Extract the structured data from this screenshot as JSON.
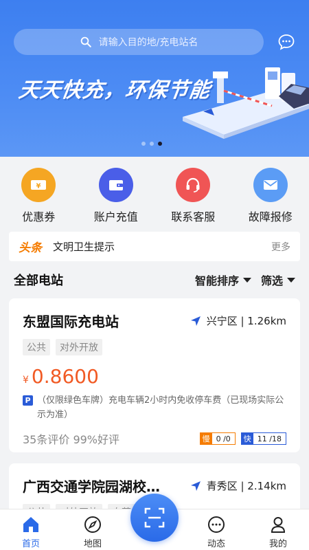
{
  "search": {
    "placeholder": "请输入目的地/充电站名",
    "icon": "search-icon"
  },
  "banner": {
    "slogan": "天天快充，环保节能",
    "carousel_active": 3,
    "carousel_count": 3
  },
  "quick_menu": [
    {
      "label": "优惠券",
      "icon": "coupon-icon",
      "color": "#f5a623"
    },
    {
      "label": "账户充值",
      "icon": "wallet-icon",
      "color": "#4a5ee8"
    },
    {
      "label": "联系客服",
      "icon": "headset-icon",
      "color": "#f05555"
    },
    {
      "label": "故障报修",
      "icon": "mail-icon",
      "color": "#5b9cf5"
    }
  ],
  "headline": {
    "tag": "头条",
    "text": "文明卫生提示",
    "more": "更多"
  },
  "section": {
    "title": "全部电站",
    "sort": "智能排序",
    "filter": "筛选"
  },
  "stations": [
    {
      "name": "东盟国际充电站",
      "district": "兴宁区",
      "distance": "1.26km",
      "tags": [
        "公共",
        "对外开放"
      ],
      "currency": "¥",
      "price": "0.8600",
      "parking_badge": "P",
      "parking_note": "（仅限绿色车牌）充电车辆2小时内免收停车费（已现场实际公示为准）",
      "reviews": "35条评价 99%好评",
      "slow_label": "慢",
      "slow_value": "0 /0",
      "fast_label": "快",
      "fast_value": "11 /18"
    },
    {
      "name": "广西交通学院园湖校…",
      "district": "青秀区",
      "distance": "2.14km",
      "tags": [
        "公共",
        "对外开放",
        "自营"
      ]
    }
  ],
  "tabbar": [
    {
      "label": "首页",
      "icon": "home-icon",
      "active": true
    },
    {
      "label": "地图",
      "icon": "compass-icon",
      "active": false
    },
    {
      "label": "",
      "icon": "scan-icon",
      "active": false
    },
    {
      "label": "动态",
      "icon": "chat-bubble-icon",
      "active": false
    },
    {
      "label": "我的",
      "icon": "user-icon",
      "active": false
    }
  ],
  "colors": {
    "primary": "#2a6ae8",
    "price": "#f15a24",
    "headline_tag": "#f57c00"
  }
}
